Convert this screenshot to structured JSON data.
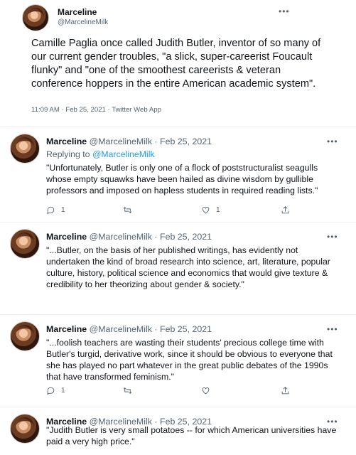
{
  "main_tweet": {
    "name": "Marceline",
    "handle": "@MarcelineMilk",
    "more_icon": "more-icon",
    "text": "Camille Paglia once called Judith Butler, inventor of so many of our current gender troubles, \"a slick, super-careerist Foucault flunky\" and \"one of the smoothest careerists & veteran conference hoppers in the entire American academic system\".",
    "meta": "11:09 AM · Feb 25, 2021 · Twitter Web App"
  },
  "replies": [
    {
      "name": "Marceline",
      "handle": "@MarcelineMilk",
      "separator": "·",
      "date": "Feb 25, 2021",
      "replying_label": "Replying to ",
      "replying_to": "@MarcelineMilk",
      "text": "\"Unfortunately, Butler is only one of a flock of poststructuralist seagulls whose empty squawks have been hailed as divine wisdom by gullible professors and imposed on hapless students in required reading lists.\"",
      "reply_count": "1",
      "retweet_count": "",
      "like_count": "1"
    },
    {
      "name": "Marceline",
      "handle": "@MarcelineMilk",
      "separator": "·",
      "date": "Feb 25, 2021",
      "text": "\"...Butler, on the basis of her published writings, has evidently not undertaken the kind of broad research into science, art, literature, popular culture, history, political science and economics that would give texture & credibility to her theorizing about gender & society.\""
    },
    {
      "name": "Marceline",
      "handle": "@MarcelineMilk",
      "separator": "·",
      "date": "Feb 25, 2021",
      "text": "\"...foolish teachers are wasting their students' precious college time with Butler's turgid, derivative work, since it should be obvious to everyone that she has played no part whatever in the great public debates of the 1990s that have transformed feminism.\"",
      "reply_count": "1",
      "retweet_count": "",
      "like_count": ""
    },
    {
      "name": "Marceline",
      "handle": "@MarcelineMilk",
      "separator": "·",
      "date": "Feb 25, 2021",
      "text": "\"Judith Butler is very small potatoes -- for which American universities have paid a very high price.\""
    }
  ],
  "colors": {
    "text": "#0f1419",
    "secondary": "#536471",
    "accent": "#1d9bf0",
    "divider": "#eff3f4"
  }
}
